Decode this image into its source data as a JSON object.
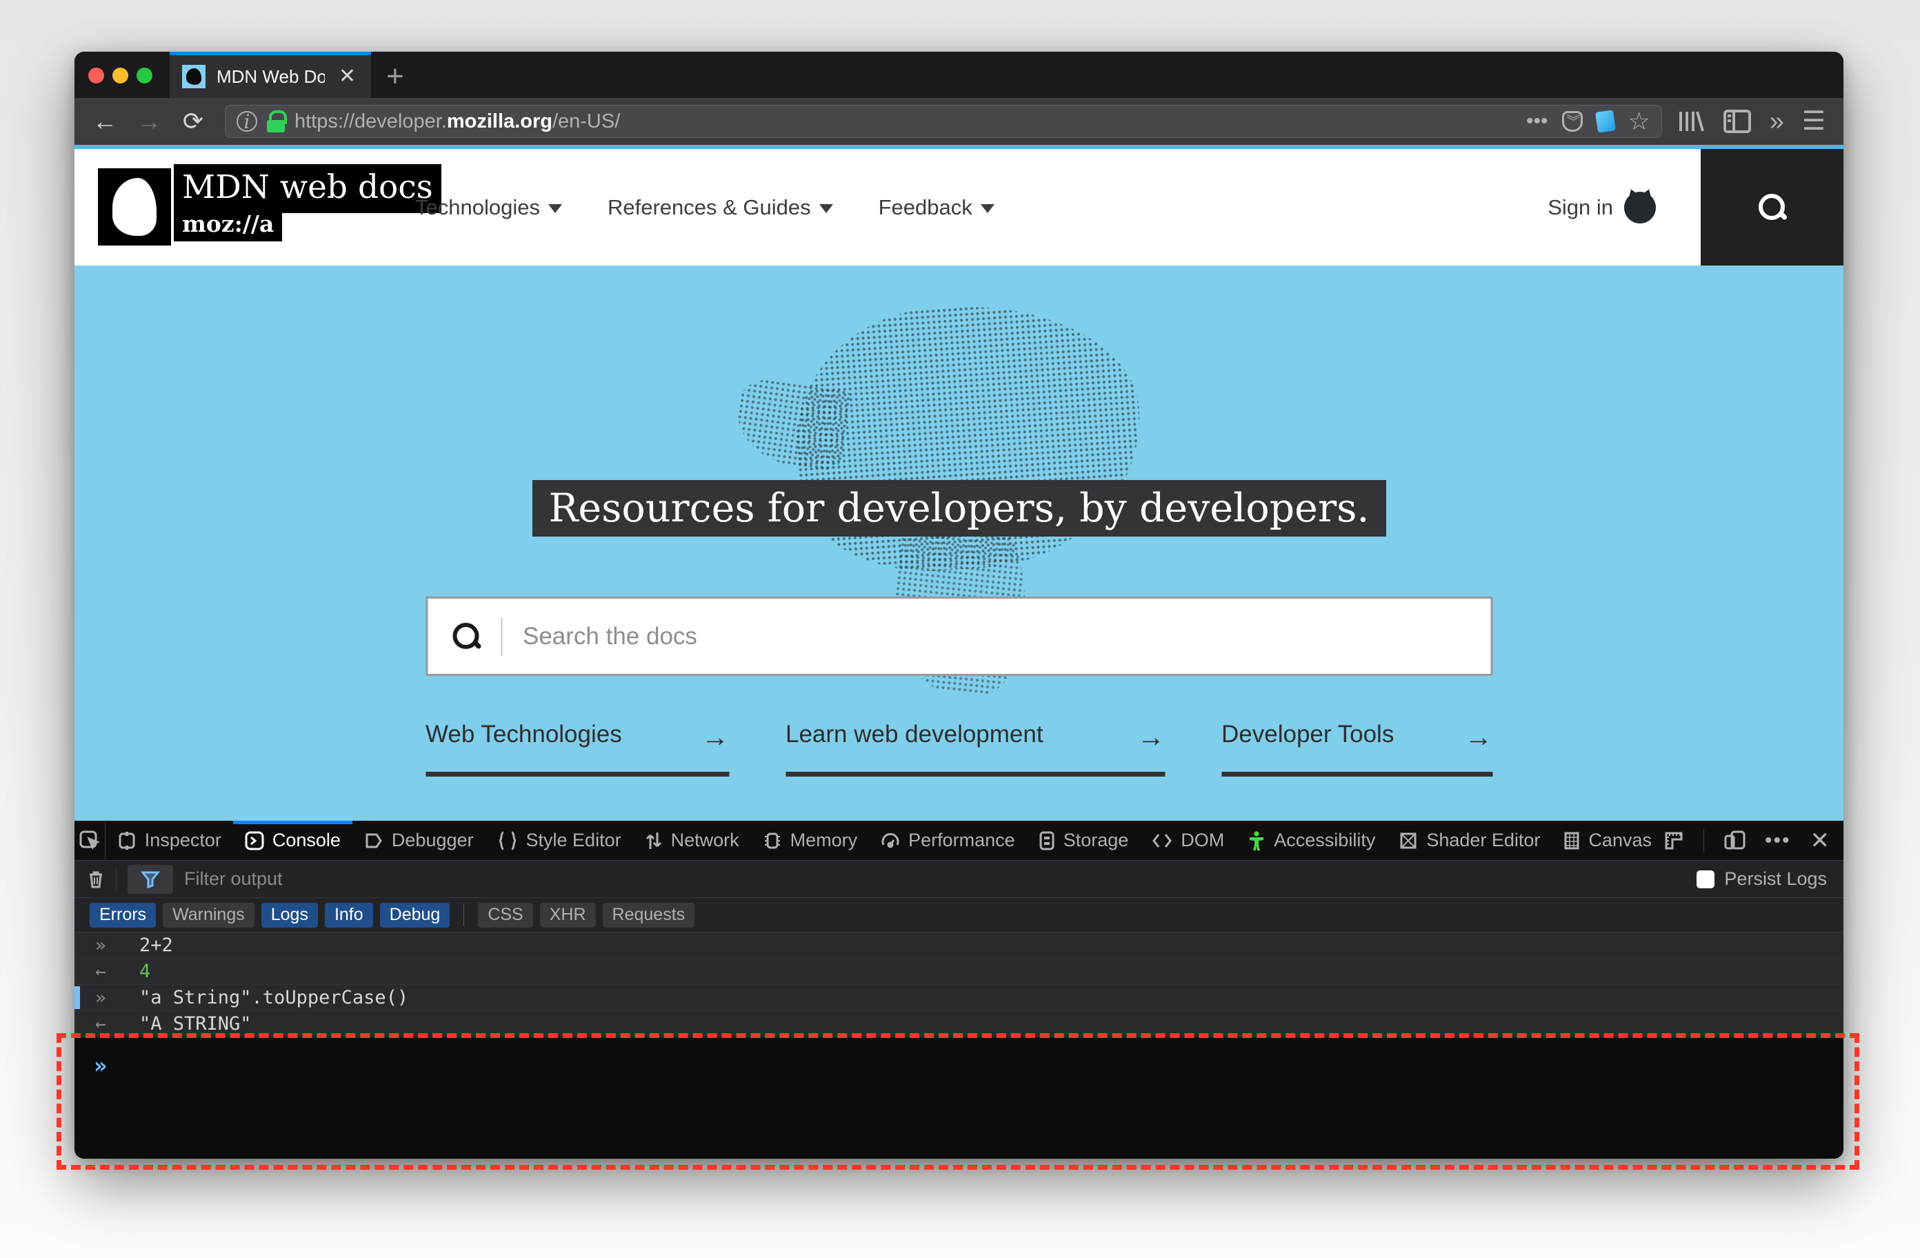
{
  "colors": {
    "accent_blue": "#0a84ff",
    "hero_blue": "#7fceec",
    "highlight_red": "#f5372c",
    "filter_active_blue": "#204e8a",
    "result_green": "#61c454",
    "prompt_blue": "#75bfff",
    "accessibility_green": "#45d945",
    "traffic_red": "#ff5f57",
    "traffic_yellow": "#febc2e",
    "traffic_green": "#28c840"
  },
  "icons": {
    "new_tab": "+",
    "tab_close": "✕",
    "back": "←",
    "forward": "→",
    "page_actions": "•••",
    "star": "☆",
    "overflow_chevrons": "»",
    "menu": "☰",
    "url_info": "i",
    "link_arrow": "→",
    "meatballs": "•••",
    "devtools_close": "✕",
    "console_mark_command": "»",
    "console_mark_result": "←"
  },
  "browser": {
    "tab_title": "MDN Web Docs",
    "url_prefix": "https://developer.",
    "url_domain": "mozilla.org",
    "url_path": "/en-US/"
  },
  "site_header": {
    "logo_title": "MDN web docs",
    "logo_sub": "moz://a",
    "nav": [
      {
        "label": "Technologies"
      },
      {
        "label": "References & Guides"
      },
      {
        "label": "Feedback"
      }
    ],
    "signin_label": "Sign in"
  },
  "hero": {
    "title": "Resources for developers, by developers.",
    "search_placeholder": "Search the docs",
    "links": [
      {
        "label": "Web Technologies"
      },
      {
        "label": "Learn web development"
      },
      {
        "label": "Developer Tools"
      }
    ]
  },
  "devtools": {
    "tabs": [
      {
        "label": "Inspector",
        "active": false
      },
      {
        "label": "Console",
        "active": true
      },
      {
        "label": "Debugger",
        "active": false
      },
      {
        "label": "Style Editor",
        "active": false
      },
      {
        "label": "Network",
        "active": false
      },
      {
        "label": "Memory",
        "active": false
      },
      {
        "label": "Performance",
        "active": false
      },
      {
        "label": "Storage",
        "active": false
      },
      {
        "label": "DOM",
        "active": false
      },
      {
        "label": "Accessibility",
        "active": false
      },
      {
        "label": "Shader Editor",
        "active": false
      },
      {
        "label": "Canvas",
        "active": false
      }
    ],
    "filter_placeholder": "Filter output",
    "persist_label": "Persist Logs",
    "filter_buttons": [
      {
        "label": "Errors",
        "active": true
      },
      {
        "label": "Warnings",
        "active": false
      },
      {
        "label": "Logs",
        "active": true
      },
      {
        "label": "Info",
        "active": true
      },
      {
        "label": "Debug",
        "active": true
      },
      {
        "label": "CSS",
        "active": false
      },
      {
        "label": "XHR",
        "active": false
      },
      {
        "label": "Requests",
        "active": false
      }
    ],
    "console_lines": [
      {
        "type": "command",
        "text": "2+2"
      },
      {
        "type": "result",
        "text": "4"
      },
      {
        "type": "command",
        "text": "\"a String\".toUpperCase()"
      },
      {
        "type": "result",
        "text": "\"A STRING\""
      }
    ]
  }
}
